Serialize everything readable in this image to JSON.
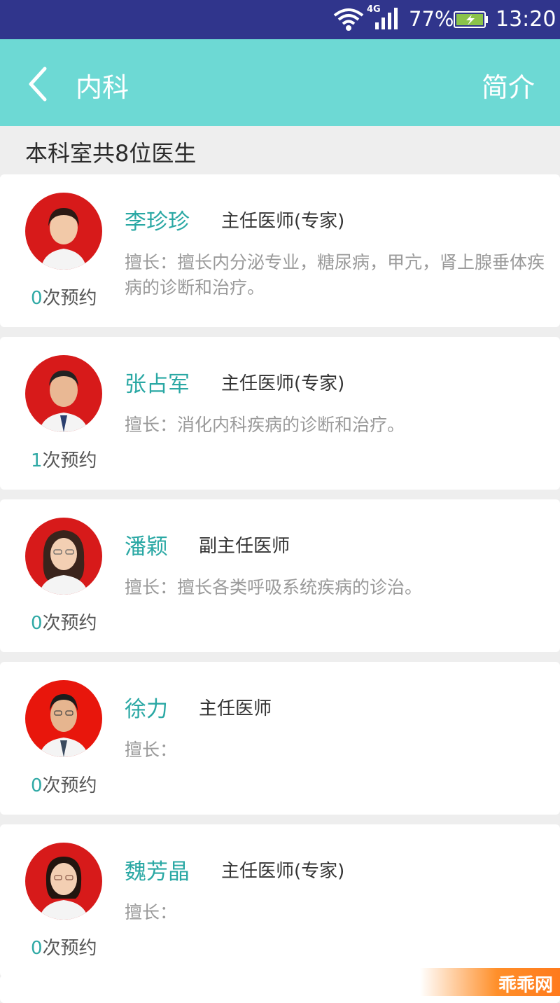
{
  "status_bar": {
    "network": "4G",
    "battery": "77%",
    "time": "13:20"
  },
  "header": {
    "title": "内科",
    "intro_label": "简介"
  },
  "summary": "本科室共8位医生",
  "doctors": [
    {
      "name": "李珍珍",
      "title": "主任医师(专家)",
      "count_num": "0",
      "count_suffix": "次预约",
      "skill": "擅长：擅长内分泌专业，糖尿病，甲亢，肾上腺垂体疾病的诊断和治疗。"
    },
    {
      "name": "张占军",
      "title": "主任医师(专家)",
      "count_num": "1",
      "count_suffix": "次预约",
      "skill": "擅长：消化内科疾病的诊断和治疗。"
    },
    {
      "name": "潘颖",
      "title": "副主任医师",
      "count_num": "0",
      "count_suffix": "次预约",
      "skill": "擅长：擅长各类呼吸系统疾病的诊治。"
    },
    {
      "name": "徐力",
      "title": "主任医师",
      "count_num": "0",
      "count_suffix": "次预约",
      "skill": "擅长："
    },
    {
      "name": "魏芳晶",
      "title": "主任医师(专家)",
      "count_num": "0",
      "count_suffix": "次预约",
      "skill": "擅长："
    }
  ],
  "watermark": "乖乖网",
  "colors": {
    "status_bar": "#30358c",
    "header": "#6dd9d4",
    "accent": "#2aa8a4",
    "avatar_bg": "#d71a1a"
  }
}
